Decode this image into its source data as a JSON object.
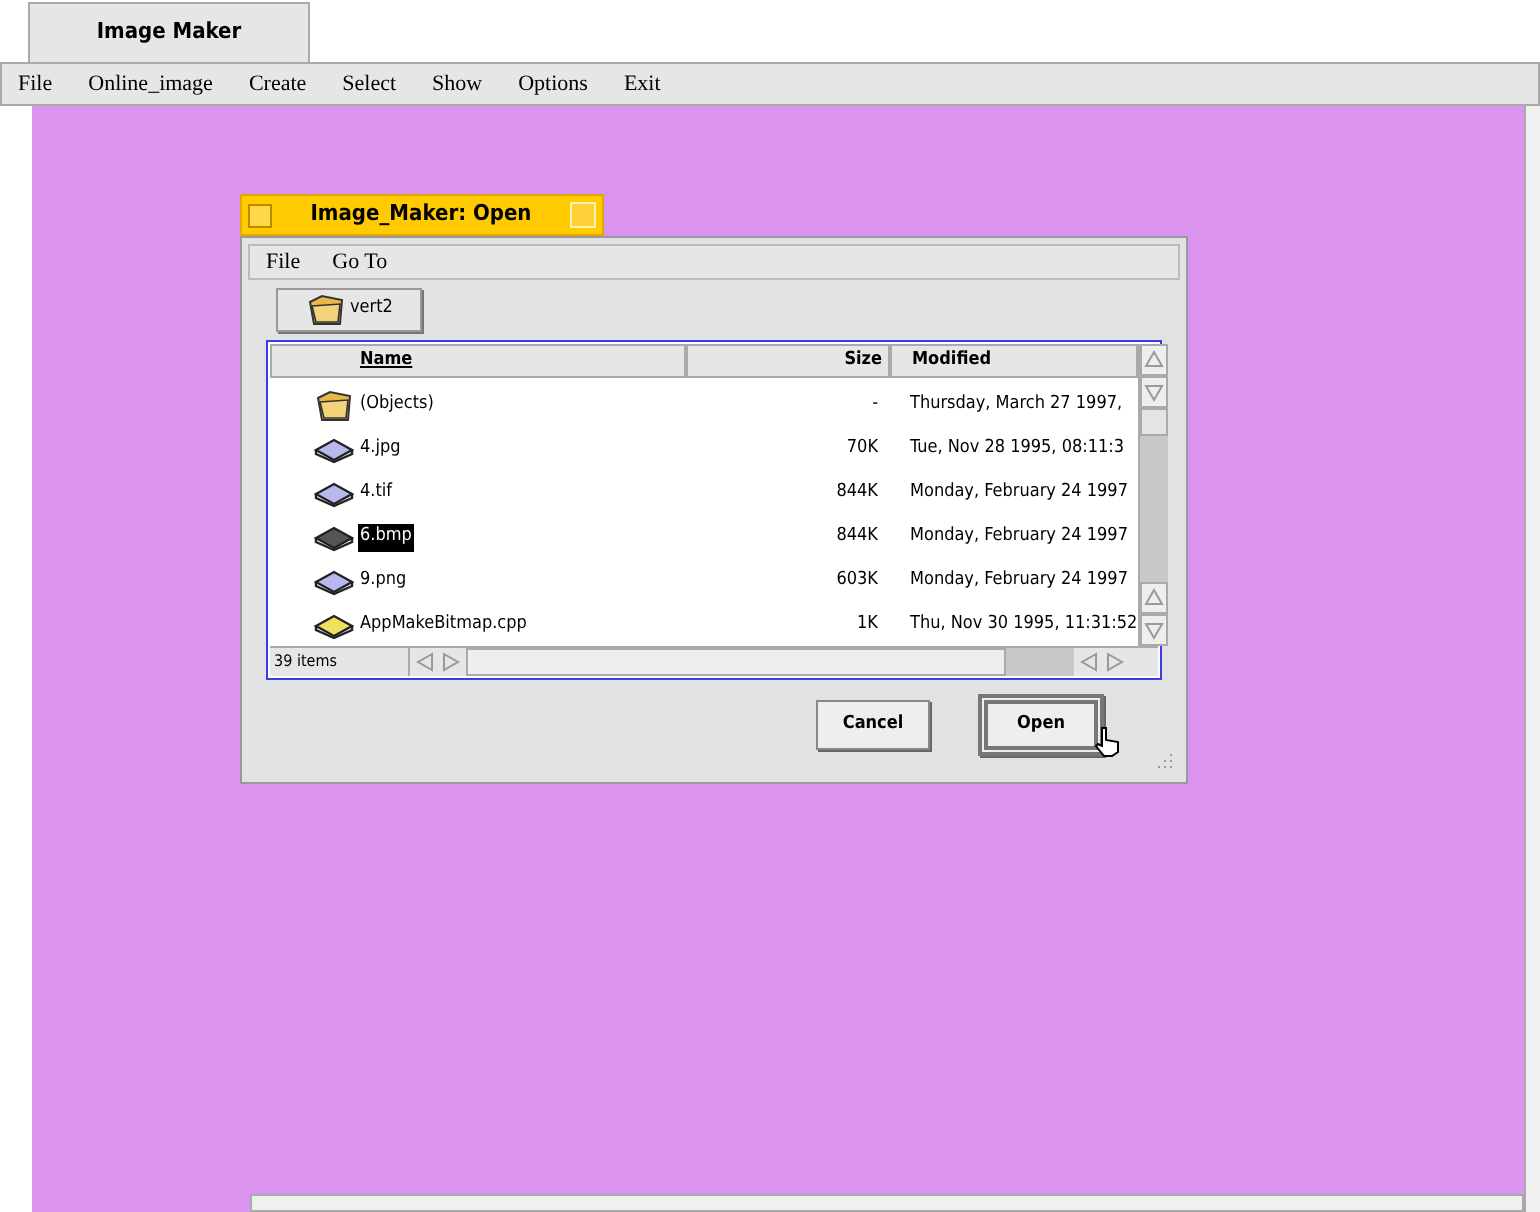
{
  "app_tab": {
    "title": "Image Maker"
  },
  "menu": [
    "File",
    "Online_image",
    "Create",
    "Select",
    "Show",
    "Options",
    "Exit"
  ],
  "dialog": {
    "title": "Image_Maker: Open",
    "menu": [
      "File",
      "Go To"
    ],
    "folder_button": "vert2",
    "columns": [
      "Name",
      "Size",
      "Modified"
    ],
    "rows": [
      {
        "kind": "folder",
        "name": "(Objects)",
        "size": "-",
        "modified": "Thursday, March 27 1997,",
        "selected": false
      },
      {
        "kind": "image",
        "name": "4.jpg",
        "size": "70K",
        "modified": "Tue, Nov 28 1995, 08:11:3",
        "selected": false
      },
      {
        "kind": "image",
        "name": "4.tif",
        "size": "844K",
        "modified": "Monday, February 24 1997",
        "selected": false
      },
      {
        "kind": "image",
        "name": "6.bmp",
        "size": "844K",
        "modified": "Monday, February 24 1997",
        "selected": true
      },
      {
        "kind": "image",
        "name": "9.png",
        "size": "603K",
        "modified": "Monday, February 24 1997",
        "selected": false
      },
      {
        "kind": "source",
        "name": "AppMakeBitmap.cpp",
        "size": "1K",
        "modified": "Thu, Nov 30 1995, 11:31:52",
        "selected": false
      }
    ],
    "item_count": "39 items",
    "buttons": [
      {
        "label": "Cancel",
        "default": false
      },
      {
        "label": "Open",
        "default": true
      }
    ]
  }
}
